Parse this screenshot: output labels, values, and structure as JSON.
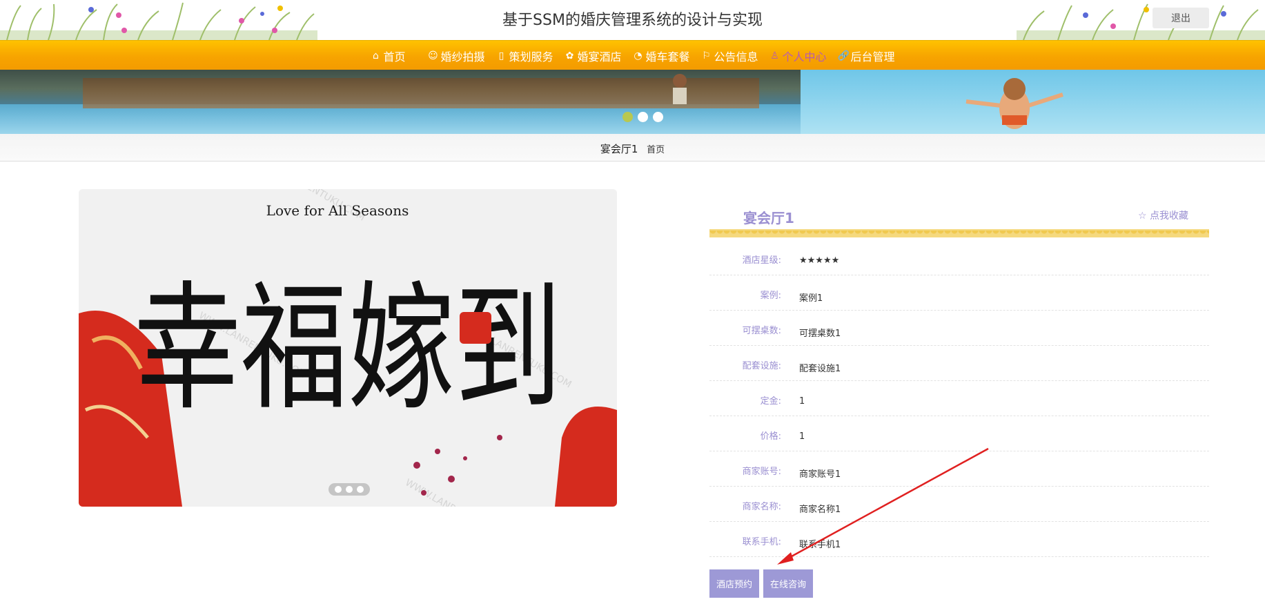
{
  "header": {
    "title": "基于SSM的婚庆管理系统的设计与实现",
    "logout_label": "退出"
  },
  "nav": {
    "items": [
      {
        "label": "首页",
        "icon": "home-icon"
      },
      {
        "label": "婚纱拍摄",
        "icon": "smile-icon"
      },
      {
        "label": "策划服务",
        "icon": "columns-icon"
      },
      {
        "label": "婚宴酒店",
        "icon": "flower-icon"
      },
      {
        "label": "婚车套餐",
        "icon": "gauge-icon"
      },
      {
        "label": "公告信息",
        "icon": "flag-icon"
      },
      {
        "label": "个人中心",
        "icon": "user-icon"
      },
      {
        "label": "后台管理",
        "icon": "link-icon"
      }
    ],
    "active_index": 6
  },
  "breadcrumb": {
    "current": "宴会厅1",
    "home": "首页"
  },
  "gallery": {
    "image_text_top": "Love for All Seasons",
    "image_text_main": "幸福嫁到",
    "image_watermark": "WWW.LANRENTUKU.COM",
    "slides": 3,
    "active_slide": 0
  },
  "detail": {
    "title": "宴会厅1",
    "favorite_label": "☆ 点我收藏",
    "fields": [
      {
        "label": "酒店星级:",
        "value": "★★★★★"
      },
      {
        "label": "案例:",
        "value": "案例1"
      },
      {
        "label": "可摆桌数:",
        "value": "可摆桌数1"
      },
      {
        "label": "配套设施:",
        "value": "配套设施1"
      },
      {
        "label": "定金:",
        "value": "1"
      },
      {
        "label": "价格:",
        "value": "1"
      },
      {
        "label": "商家账号:",
        "value": "商家账号1"
      },
      {
        "label": "商家名称:",
        "value": "商家名称1"
      },
      {
        "label": "联系手机:",
        "value": "联系手机1"
      }
    ],
    "actions": {
      "reserve_label": "酒店预约",
      "consult_label": "在线咨询"
    }
  },
  "colors": {
    "accent": "#9a8fd1",
    "nav_bg": "#f7a400",
    "button": "#9d99d6",
    "active_nav": "#b55bb3",
    "annotation_arrow": "#e02020"
  }
}
